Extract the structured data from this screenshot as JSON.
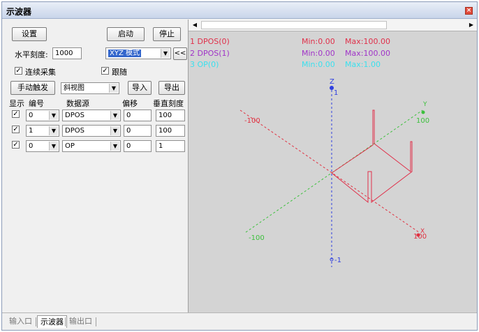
{
  "window": {
    "title": "示波器"
  },
  "controls": {
    "settings_label": "设置",
    "start_label": "启动",
    "stop_label": "停止",
    "hscale_label": "水平刻度:",
    "hscale_value": "1000",
    "mode_value": "XYZ 模式",
    "collapse_label": "<<",
    "continuous_label": "连续采集",
    "continuous_checked": true,
    "follow_label": "跟随",
    "follow_checked": true,
    "manual_trigger_label": "手动触发",
    "view_value": "斜视图",
    "import_label": "导入",
    "export_label": "导出"
  },
  "channel_table": {
    "headers": [
      "显示",
      "编号",
      "数据源",
      "偏移",
      "垂直刻度"
    ],
    "rows": [
      {
        "show": true,
        "number": "0",
        "source": "DPOS",
        "offset": "0",
        "scale": "100"
      },
      {
        "show": true,
        "number": "1",
        "source": "DPOS",
        "offset": "0",
        "scale": "100"
      },
      {
        "show": true,
        "number": "0",
        "source": "OP",
        "offset": "0",
        "scale": "1"
      }
    ]
  },
  "scope": {
    "signals": [
      {
        "name": "1 DPOS(0)",
        "min": "Min:0.00",
        "max": "Max:100.00",
        "color": "#e0304a"
      },
      {
        "name": "2 DPOS(1)",
        "min": "Min:0.00",
        "max": "Max:100.00",
        "color": "#a034c8"
      },
      {
        "name": "3 OP(0)",
        "min": "Min:0.00",
        "max": "Max:1.00",
        "color": "#3be0ee"
      }
    ],
    "axes": {
      "x": {
        "name": "X",
        "pos_label": "100",
        "neg_label": "-100",
        "color": "#e03040"
      },
      "y": {
        "name": "Y",
        "pos_label": "100",
        "neg_label": "-100",
        "color": "#3cc03c"
      },
      "z": {
        "name": "Z",
        "pos_label": "1",
        "neg_label": "-1",
        "color": "#3040e0"
      }
    },
    "background": "#d4d4d4"
  },
  "bottom_tabs": [
    {
      "label": "输入口",
      "active": false
    },
    {
      "label": "示波器",
      "active": true
    },
    {
      "label": "输出口",
      "active": false
    }
  ]
}
